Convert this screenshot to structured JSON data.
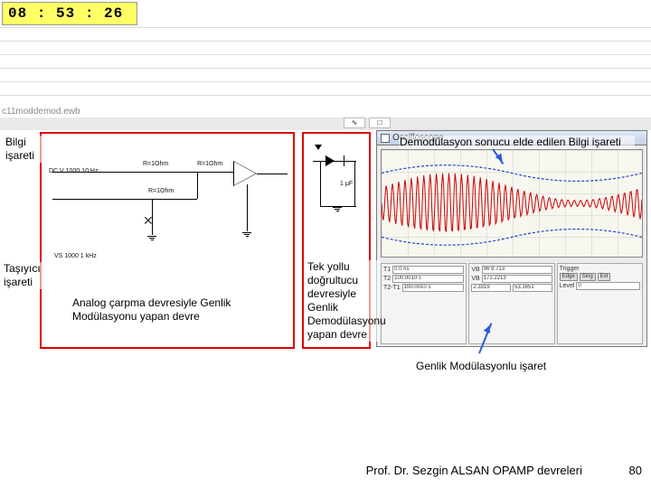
{
  "clock": {
    "text": "08 : 53 : 26"
  },
  "filepath": "c11moddemod.ewb",
  "oscilloscope": {
    "title": "Oscilloscope",
    "panelA": {
      "l1": "T1",
      "l2": "T2",
      "l3": "T2-T1",
      "v1": "0.0 ns",
      "v2": "100.0010 s",
      "v3": "100.0010 s"
    },
    "panelB": {
      "l1": "VB",
      "l2": "VB",
      "l3": "",
      "v1": "96 9.713",
      "v2": "172.2213",
      "v3": "2.3319",
      "v4": "53.1651"
    },
    "panelC": {
      "l1": "Trigger",
      "btn1": "Edge",
      "btn2": "Sing",
      "btn3": "Ext",
      "level": "0"
    }
  },
  "schematic": {
    "r1": "R=1Ohm",
    "r2": "R=1Ohm",
    "r3": "R=1Ohm",
    "vs1": "DC V 1000 10 Hz",
    "vs2": "VS 1000 1 kHz",
    "fc": "1 μF"
  },
  "notes": {
    "bilgi": "Bilgi işareti",
    "tasiyici": "Taşıyıcı işareti",
    "analog": "Analog çarpma devresiyle Genlik Modülasyonu yapan devre",
    "tekyollu": "Tek yollu doğrultucu devresiyle Genlik Demodülasyonu yapan devre",
    "demod": "Demodülasyon sonucu elde edilen Bilgi işareti",
    "genlik": "Genlik Modülasyonlu işaret"
  },
  "footer": {
    "author": "Prof. Dr. Sezgin ALSAN  OPAMP devreleri",
    "page": "80"
  }
}
